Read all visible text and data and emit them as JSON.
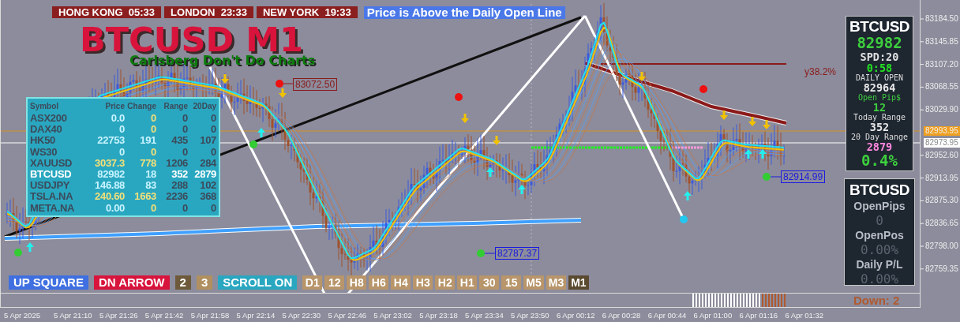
{
  "session_clocks": [
    {
      "text": "HONG KONG  05:33"
    },
    {
      "text": "LONDON  23:33"
    },
    {
      "text": "NEW YORK  19:33"
    }
  ],
  "status_banner": "Price is Above the Daily Open Line",
  "title": "BTCUSD M1",
  "subtitle": "Carlsberg Don't Do Charts",
  "market_table": {
    "columns": [
      "Symbol",
      "Price",
      "Change",
      "Range",
      "20Day"
    ],
    "rows": [
      {
        "symbol": "ASX200",
        "price": {
          "text": "0.0",
          "color": "#c8f4ff"
        },
        "change": {
          "text": "0",
          "color": "#f2e07a"
        },
        "range": "0",
        "day20": "0",
        "selected": false
      },
      {
        "symbol": "DAX40",
        "price": {
          "text": "0",
          "color": "#c8f4ff"
        },
        "change": {
          "text": "0",
          "color": "#f2e07a"
        },
        "range": "0",
        "day20": "0",
        "selected": false
      },
      {
        "symbol": "HK50",
        "price": {
          "text": "22753",
          "color": "#c8f4ff"
        },
        "change": {
          "text": "191",
          "color": "#c8f4ff"
        },
        "range": "435",
        "day20": "107",
        "selected": false
      },
      {
        "symbol": "WS30",
        "price": {
          "text": "0",
          "color": "#c8f4ff"
        },
        "change": {
          "text": "0",
          "color": "#f2e07a"
        },
        "range": "0",
        "day20": "0",
        "selected": false
      },
      {
        "symbol": "XAUUSD",
        "price": {
          "text": "3037.3",
          "color": "#f2e07a"
        },
        "change": {
          "text": "778",
          "color": "#f2e07a"
        },
        "range": "1206",
        "day20": "284",
        "selected": false
      },
      {
        "symbol": "BTCUSD",
        "price": {
          "text": "82982",
          "color": "#c8f4ff"
        },
        "change": {
          "text": "18",
          "color": "#c8f4ff"
        },
        "range": "352",
        "day20": "2879",
        "selected": true
      },
      {
        "symbol": "USDJPY",
        "price": {
          "text": "146.88",
          "color": "#c8f4ff"
        },
        "change": {
          "text": "83",
          "color": "#c8f4ff"
        },
        "range": "288",
        "day20": "102",
        "selected": false
      },
      {
        "symbol": "TSLA.NA",
        "price": {
          "text": "240.60",
          "color": "#f2e07a"
        },
        "change": {
          "text": "1663",
          "color": "#f2e07a"
        },
        "range": "2236",
        "day20": "368",
        "selected": false
      },
      {
        "symbol": "META.NA",
        "price": {
          "text": "0.00",
          "color": "#c8f4ff"
        },
        "change": {
          "text": "0",
          "color": "#f2e07a"
        },
        "range": "0",
        "day20": "0",
        "selected": false
      }
    ]
  },
  "price_labels": [
    {
      "text": "83072.50",
      "kind": "high"
    },
    {
      "text": "82787.37",
      "kind": "low"
    },
    {
      "text": "82914.99",
      "kind": "low"
    }
  ],
  "fib_label": "y38.2%",
  "info_panel": [
    {
      "text": "BTCUSD",
      "kind": "heading",
      "color": "#ffffff"
    },
    {
      "text": "82982",
      "kind": "large",
      "color": "#3ecf3e"
    },
    {
      "text": "SPD:20",
      "kind": "medium",
      "color": "#e0e0e0"
    },
    {
      "text": "0:58",
      "kind": "medium",
      "color": "#22e022"
    },
    {
      "text": "DAILY OPEN",
      "kind": "small",
      "color": "#dddddd"
    },
    {
      "text": "82964",
      "kind": "medium",
      "color": "#e8e8e8"
    },
    {
      "text": "Open Pip$",
      "kind": "small",
      "color": "#3ecf3e"
    },
    {
      "text": "12",
      "kind": "medium",
      "color": "#3ecf3e"
    },
    {
      "text": "Today Range",
      "kind": "small",
      "color": "#dddddd"
    },
    {
      "text": "352",
      "kind": "medium",
      "color": "#e8e8e8"
    },
    {
      "text": "20 Day Range",
      "kind": "small",
      "color": "#dddddd"
    },
    {
      "text": "2879",
      "kind": "medium",
      "color": "#ff88e0"
    },
    {
      "text": "0.4%",
      "kind": "large",
      "color": "#3ecf3e"
    }
  ],
  "position_panel": [
    {
      "text": "BTCUSD",
      "kind": "heading"
    },
    {
      "text": "OpenPips",
      "kind": "label"
    },
    {
      "text": "0",
      "kind": "value"
    },
    {
      "text": "OpenPos",
      "kind": "label"
    },
    {
      "text": "0.00%",
      "kind": "value"
    },
    {
      "text": "Daily P/L",
      "kind": "label"
    },
    {
      "text": "0.00%",
      "kind": "value"
    }
  ],
  "control_buttons": [
    {
      "label": "UP SQUARE",
      "color": "#3f6fe0"
    },
    {
      "label": "DN ARROW",
      "color": "#d8143c"
    },
    {
      "label": "2",
      "color": "#6e5a3a"
    },
    {
      "label": "3",
      "color": "#b09060"
    },
    {
      "label": "SCROLL ON",
      "color": "#2aa7c0"
    }
  ],
  "timeframes": [
    {
      "label": "D1",
      "selected": false
    },
    {
      "label": "12",
      "selected": false
    },
    {
      "label": "H8",
      "selected": false
    },
    {
      "label": "H6",
      "selected": false
    },
    {
      "label": "H4",
      "selected": false
    },
    {
      "label": "H3",
      "selected": false
    },
    {
      "label": "H2",
      "selected": false
    },
    {
      "label": "H1",
      "selected": false
    },
    {
      "label": "30",
      "selected": false
    },
    {
      "label": "15",
      "selected": false
    },
    {
      "label": "M5",
      "selected": false
    },
    {
      "label": "M3",
      "selected": false
    },
    {
      "label": "M1",
      "selected": true
    }
  ],
  "price_axis": [
    {
      "text": "83184.50",
      "kind": "plain"
    },
    {
      "text": "83145.85",
      "kind": "plain"
    },
    {
      "text": "83107.20",
      "kind": "plain"
    },
    {
      "text": "83068.55",
      "kind": "plain"
    },
    {
      "text": "83029.90",
      "kind": "plain"
    },
    {
      "text": "82993.95",
      "kind": "ask"
    },
    {
      "text": "82973.95",
      "kind": "bid"
    },
    {
      "text": "82952.60",
      "kind": "plain"
    },
    {
      "text": "82913.95",
      "kind": "plain"
    },
    {
      "text": "82875.30",
      "kind": "plain"
    },
    {
      "text": "82836.65",
      "kind": "plain"
    },
    {
      "text": "82798.00",
      "kind": "plain"
    },
    {
      "text": "82759.35",
      "kind": "plain"
    }
  ],
  "histogram_label": "Down: 2",
  "time_axis": [
    "5 Apr 2025",
    "5 Apr 21:10",
    "5 Apr 21:26",
    "5 Apr 21:42",
    "5 Apr 21:58",
    "5 Apr 22:14",
    "5 Apr 22:30",
    "5 Apr 22:46",
    "5 Apr 23:02",
    "5 Apr 23:18",
    "5 Apr 23:34",
    "5 Apr 23:50",
    "6 Apr 00:12",
    "6 Apr 00:28",
    "6 Apr 00:44",
    "6 Apr 01:00",
    "6 Apr 01:16",
    "6 Apr 01:32"
  ]
}
